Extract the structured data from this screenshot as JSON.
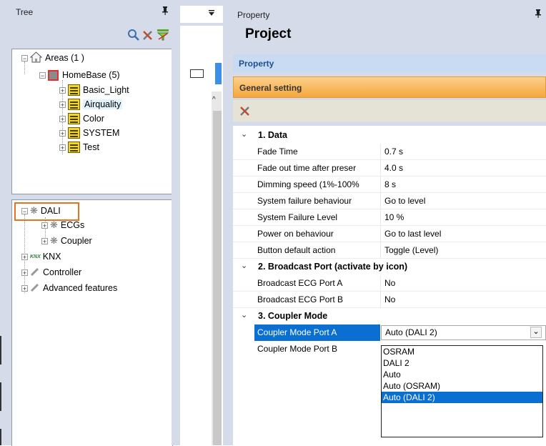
{
  "tree_panel": {
    "title": "Tree",
    "pin": "ᵖ",
    "areas": {
      "label": "Areas (1 )",
      "children": [
        {
          "label": "HomeBase (5)",
          "children": [
            {
              "label": "Basic_Light"
            },
            {
              "label": "Airquality"
            },
            {
              "label": "Color"
            },
            {
              "label": "SYSTEM"
            },
            {
              "label": "Test"
            }
          ]
        }
      ]
    },
    "devices": [
      {
        "label": "DALI",
        "children": [
          {
            "label": "ECGs"
          },
          {
            "label": "Coupler"
          }
        ]
      },
      {
        "label": "KNX"
      },
      {
        "label": "Controller"
      },
      {
        "label": "Advanced features"
      }
    ]
  },
  "property_panel": {
    "title": "Property",
    "heading": "Project",
    "section_header": "Property",
    "group_tab": "General setting",
    "categories": [
      {
        "title": "1. Data",
        "rows": [
          {
            "key": "Fade Time",
            "value": "0.7 s"
          },
          {
            "key": "Fade out time after preser",
            "value": "4.0 s"
          },
          {
            "key": "Dimming speed (1%-100%",
            "value": "8 s"
          },
          {
            "key": "System failure behaviour",
            "value": "Go to level"
          },
          {
            "key": "System Failure Level",
            "value": "10 %"
          },
          {
            "key": "Power on behaviour",
            "value": "Go to last level"
          },
          {
            "key": "Button default action",
            "value": "Toggle (Level)"
          }
        ]
      },
      {
        "title": "2. Broadcast Port (activate by icon)",
        "rows": [
          {
            "key": "Broadcast ECG Port A",
            "value": "No"
          },
          {
            "key": "Broadcast ECG Port B",
            "value": "No"
          }
        ]
      },
      {
        "title": "3. Coupler Mode",
        "rows": [
          {
            "key": "Coupler Mode Port A",
            "value": "Auto (DALI 2)"
          },
          {
            "key": "Coupler Mode Port B",
            "value": ""
          }
        ]
      }
    ],
    "dropdown_options": [
      "OSRAM",
      "DALI 2",
      "Auto",
      "Auto (OSRAM)",
      "Auto (DALI 2)"
    ],
    "selected_option": "Auto (DALI 2)"
  },
  "colors": {
    "selection": "#0b6fd1",
    "highlight_border": "#e8731f",
    "group_tab": "#f7b24e"
  }
}
